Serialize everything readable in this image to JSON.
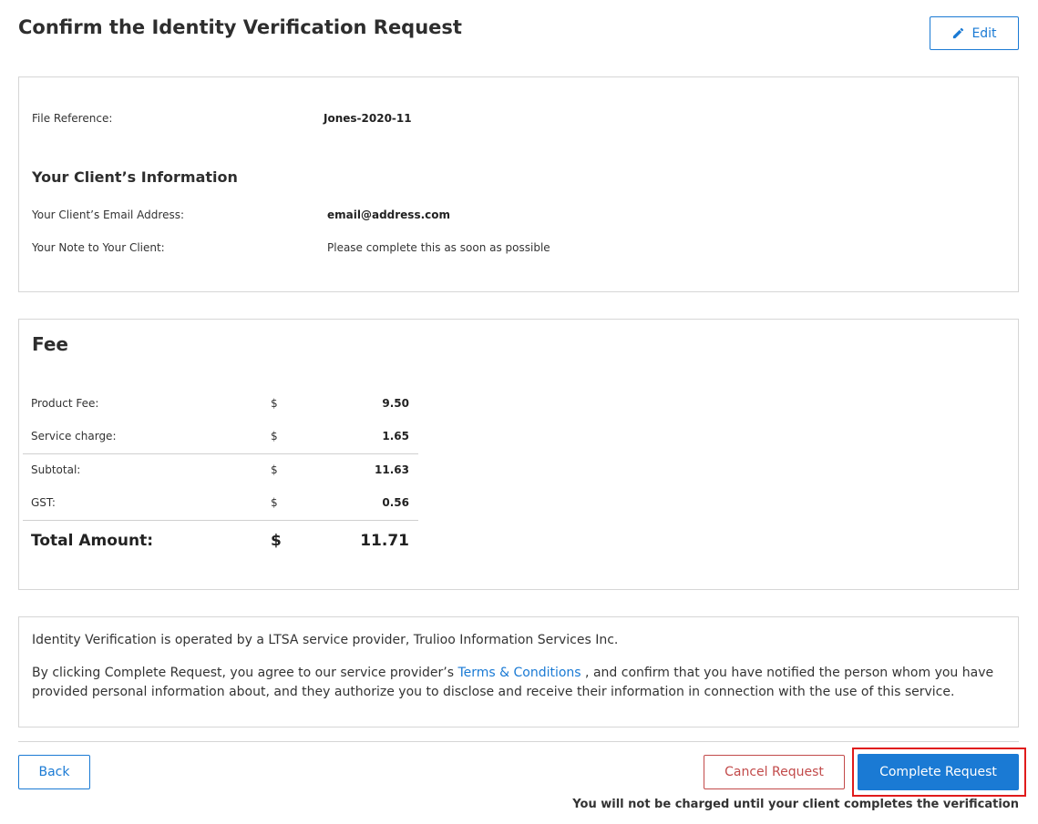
{
  "header": {
    "title": "Confirm the Identity Verification Request",
    "edit_label": "Edit",
    "edit_icon": "pencil-icon"
  },
  "info": {
    "file_reference_label": "File Reference:",
    "file_reference_value": "Jones-2020-11",
    "client_heading": "Your Client’s Information",
    "email_label": "Your Client’s Email Address:",
    "email_value": "email@address.com",
    "note_label": "Your Note to Your Client:",
    "note_value": "Please complete this as soon as possible"
  },
  "fee": {
    "heading": "Fee",
    "rows": [
      {
        "label": "Product Fee:",
        "currency": "$",
        "amount": "9.50"
      },
      {
        "label": "Service charge:",
        "currency": "$",
        "amount": "1.65"
      },
      {
        "label": "Subtotal:",
        "currency": "$",
        "amount": "11.63"
      },
      {
        "label": "GST:",
        "currency": "$",
        "amount": "0.56"
      }
    ],
    "total": {
      "label": "Total Amount:",
      "currency": "$",
      "amount": "11.71"
    }
  },
  "terms": {
    "line1": "Identity Verification is operated by a LTSA service provider, Trulioo Information Services Inc.",
    "line2_before": "By clicking Complete Request, you agree to our service provider’s ",
    "link_text": "Terms & Conditions",
    "line2_after": " , and confirm that you have notified the person whom you have",
    "line3": "provided personal information about, and they authorize you to disclose and receive their information in connection with the use of this service."
  },
  "actions": {
    "back_label": "Back",
    "cancel_label": "Cancel Request",
    "complete_label": "Complete Request",
    "notice": "You will not be charged until your client completes the verification"
  },
  "colors": {
    "accent": "#1a7ad4",
    "cancel": "#c24a4a",
    "highlight": "#e01b1b"
  }
}
